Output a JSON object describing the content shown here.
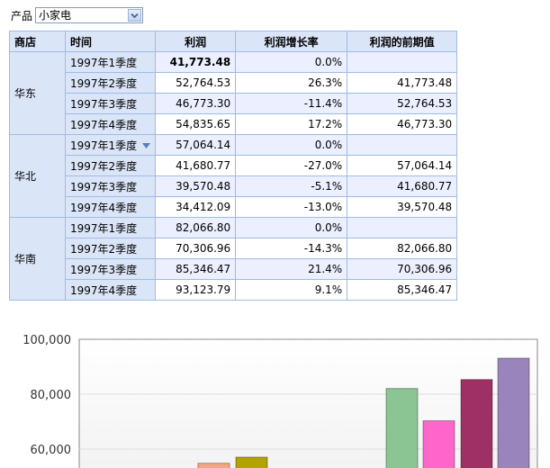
{
  "filter": {
    "label": "产品",
    "value": "小家电"
  },
  "table": {
    "headers": [
      "商店",
      "时间",
      "利润",
      "利润增长率",
      "利润的前期值"
    ],
    "groups": [
      {
        "store": "华东",
        "rows": [
          {
            "time": "1997年1季度",
            "profit": "41,773.48",
            "growth": "0.0%",
            "prev": ""
          },
          {
            "time": "1997年2季度",
            "profit": "52,764.53",
            "growth": "26.3%",
            "prev": "41,773.48"
          },
          {
            "time": "1997年3季度",
            "profit": "46,773.30",
            "growth": "-11.4%",
            "prev": "52,764.53"
          },
          {
            "time": "1997年4季度",
            "profit": "54,835.65",
            "growth": "17.2%",
            "prev": "46,773.30"
          }
        ]
      },
      {
        "store": "华北",
        "rows": [
          {
            "time": "1997年1季度",
            "profit": "57,064.14",
            "growth": "0.0%",
            "prev": ""
          },
          {
            "time": "1997年2季度",
            "profit": "41,680.77",
            "growth": "-27.0%",
            "prev": "57,064.14"
          },
          {
            "time": "1997年3季度",
            "profit": "39,570.48",
            "growth": "-5.1%",
            "prev": "41,680.77"
          },
          {
            "time": "1997年4季度",
            "profit": "34,412.09",
            "growth": "-13.0%",
            "prev": "39,570.48"
          }
        ]
      },
      {
        "store": "华南",
        "rows": [
          {
            "time": "1997年1季度",
            "profit": "82,066.80",
            "growth": "0.0%",
            "prev": ""
          },
          {
            "time": "1997年2季度",
            "profit": "70,306.96",
            "growth": "-14.3%",
            "prev": "82,066.80"
          },
          {
            "time": "1997年3季度",
            "profit": "85,346.47",
            "growth": "21.4%",
            "prev": "70,306.96"
          },
          {
            "time": "1997年4季度",
            "profit": "93,123.79",
            "growth": "9.1%",
            "prev": "85,346.47"
          }
        ]
      }
    ]
  },
  "chart_data": {
    "type": "bar",
    "ylim": [
      50000,
      100000
    ],
    "yticks": [
      "60,000",
      "80,000",
      "100,000"
    ],
    "ytick_values": [
      60000,
      80000,
      100000
    ],
    "grid": true,
    "bars": [
      {
        "value": 54835.65,
        "color": "#f2a884"
      },
      {
        "value": 57064.14,
        "color": "#b3a300"
      },
      {
        "value": 82066.8,
        "color": "#8cc594"
      },
      {
        "value": 70306.96,
        "color": "#ff66cc"
      },
      {
        "value": 85346.47,
        "color": "#9e3066"
      },
      {
        "value": 93123.79,
        "color": "#9a84bc"
      }
    ]
  },
  "colors": {
    "header_bg": "#dbe5f8",
    "row_alt_bg": "#ebefff",
    "border": "#9ebbe6"
  },
  "icons": {
    "select_arrow": "chevron-down-icon",
    "dropdown_arrow": "triangle-down-icon"
  }
}
